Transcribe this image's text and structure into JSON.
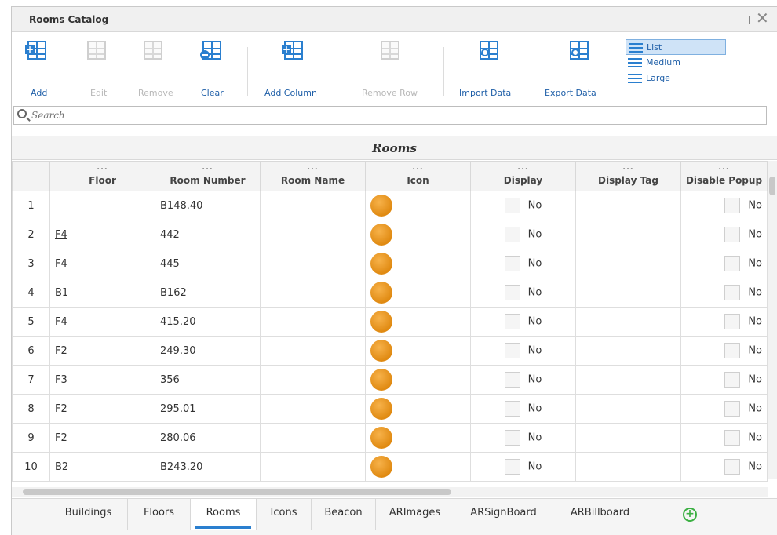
{
  "window": {
    "title": "Rooms Catalog"
  },
  "toolbar": {
    "add": "Add",
    "edit": "Edit",
    "remove": "Remove",
    "clear": "Clear",
    "add_column": "Add Column",
    "remove_row": "Remove Row",
    "import_data": "Import Data",
    "export_data": "Export Data",
    "view_list": "List",
    "view_medium": "Medium",
    "view_large": "Large"
  },
  "search": {
    "placeholder": "Search"
  },
  "grid": {
    "title": "Rooms",
    "dots": "...",
    "columns": [
      "Floor",
      "Room Number",
      "Room Name",
      "Icon",
      "Display",
      "Display Tag",
      "Disable Popup"
    ],
    "rows": [
      {
        "n": "1",
        "floor": "",
        "room": "B148.40",
        "name": "",
        "display": "No",
        "popup": "No"
      },
      {
        "n": "2",
        "floor": "F4",
        "room": "442",
        "name": "",
        "display": "No",
        "popup": "No"
      },
      {
        "n": "3",
        "floor": "F4",
        "room": "445",
        "name": "",
        "display": "No",
        "popup": "No"
      },
      {
        "n": "4",
        "floor": "B1",
        "room": "B162",
        "name": "",
        "display": "No",
        "popup": "No"
      },
      {
        "n": "5",
        "floor": "F4",
        "room": "415.20",
        "name": "",
        "display": "No",
        "popup": "No"
      },
      {
        "n": "6",
        "floor": "F2",
        "room": "249.30",
        "name": "",
        "display": "No",
        "popup": "No"
      },
      {
        "n": "7",
        "floor": "F3",
        "room": "356",
        "name": "",
        "display": "No",
        "popup": "No"
      },
      {
        "n": "8",
        "floor": "F2",
        "room": "295.01",
        "name": "",
        "display": "No",
        "popup": "No"
      },
      {
        "n": "9",
        "floor": "F2",
        "room": "280.06",
        "name": "",
        "display": "No",
        "popup": "No"
      },
      {
        "n": "10",
        "floor": "B2",
        "room": "B243.20",
        "name": "",
        "display": "No",
        "popup": "No"
      }
    ]
  },
  "tabs": [
    "Buildings",
    "Floors",
    "Rooms",
    "Icons",
    "Beacon",
    "ARImages",
    "ARSignBoard",
    "ARBillboard"
  ],
  "colors": {
    "accent": "#2a7fcf",
    "icon_orange": "#e08a12",
    "add_green": "#3cb043"
  }
}
